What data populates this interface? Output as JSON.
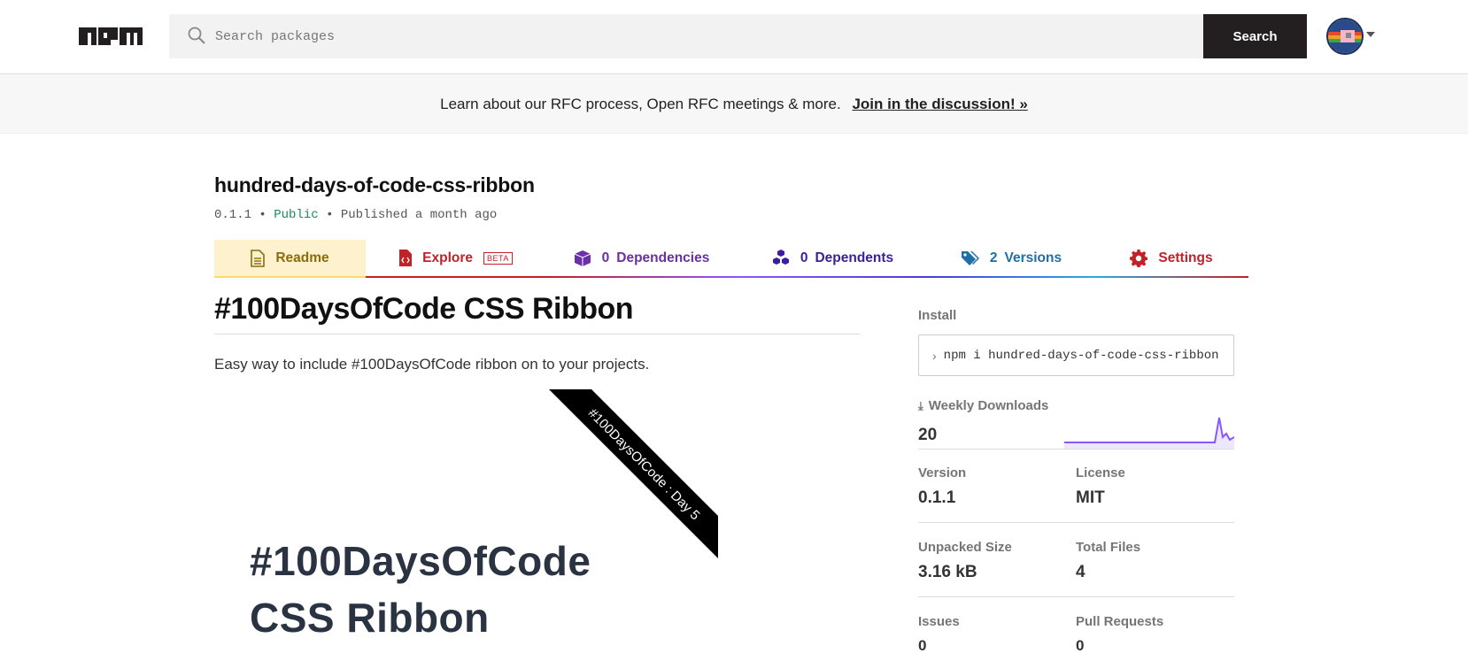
{
  "header": {
    "logo_text": "npm",
    "search_placeholder": "Search packages",
    "search_button": "Search"
  },
  "banner": {
    "text": "Learn about our RFC process, Open RFC meetings & more.",
    "link": "Join in the discussion! »"
  },
  "package": {
    "name": "hundred-days-of-code-css-ribbon",
    "version": "0.1.1",
    "visibility": "Public",
    "published": "Published a month ago",
    "sep": "•"
  },
  "tabs": [
    {
      "label": "Readme",
      "icon": "file-icon"
    },
    {
      "label": "Explore",
      "badge": "BETA",
      "icon": "file-code-icon"
    },
    {
      "count": "0",
      "label": "Dependencies",
      "icon": "box-icon"
    },
    {
      "count": "0",
      "label": "Dependents",
      "icon": "boxes-icon"
    },
    {
      "count": "2",
      "label": "Versions",
      "icon": "tags-icon"
    },
    {
      "label": "Settings",
      "icon": "gear-icon"
    }
  ],
  "readme": {
    "heading": "#100DaysOfCode CSS Ribbon",
    "description": "Easy way to include #100DaysOfCode ribbon on to your projects.",
    "ribbon_text": "#100DaysOfCode : Day 5",
    "demo_line1": "#100DaysOfCode",
    "demo_line2": "CSS Ribbon"
  },
  "sidebar": {
    "install_label": "Install",
    "install_cmd": "npm i hundred-days-of-code-css-ribbon",
    "weekly_downloads_label": "Weekly Downloads",
    "weekly_downloads": "20",
    "version_label": "Version",
    "version": "0.1.1",
    "license_label": "License",
    "license": "MIT",
    "unpacked_size_label": "Unpacked Size",
    "unpacked_size": "3.16 kB",
    "total_files_label": "Total Files",
    "total_files": "4",
    "issues_label": "Issues",
    "issues": "0",
    "pull_requests_label": "Pull Requests",
    "pull_requests": "0"
  },
  "colors": {
    "readme_tab": "#fdf2cd",
    "explore": "#c12127",
    "dependencies": "#6b2fa6",
    "dependents": "#3b1d9f",
    "versions": "#1e6fa8",
    "settings": "#c12127",
    "sparkline": "#8956ff"
  }
}
